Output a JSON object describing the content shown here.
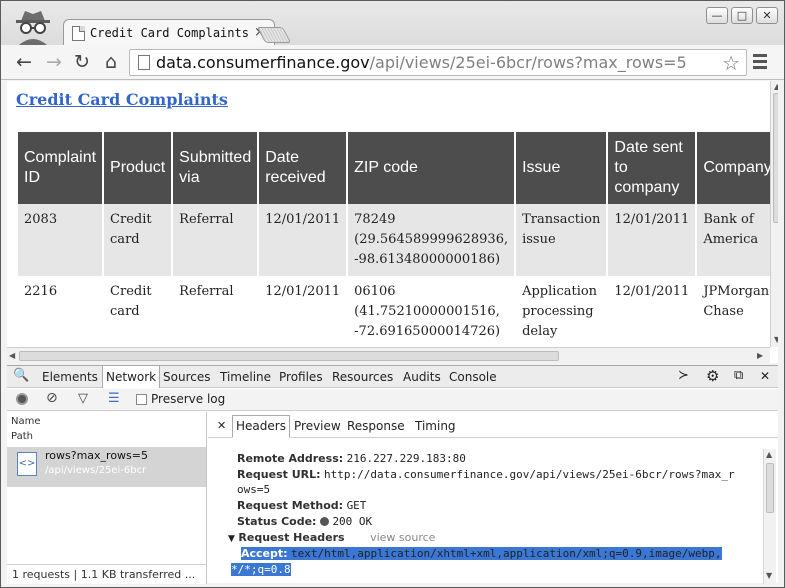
{
  "browser": {
    "tab_title": "Credit Card Complaints",
    "url_host": "data.consumerfinance.gov",
    "url_path": "/api/views/25ei-6bcr/rows?max_rows=5",
    "window_buttons": {
      "minimize": "—",
      "maximize": "□",
      "close": "✕"
    },
    "tab_close": "×"
  },
  "page": {
    "title": "Credit Card Complaints",
    "columns": [
      "Complaint ID",
      "Product",
      "Submitted via",
      "Date received",
      "ZIP code",
      "Issue",
      "Date sent to company",
      "Company"
    ],
    "rows": [
      [
        "2083",
        "Credit card",
        "Referral",
        "12/01/2011",
        "78249 (29.564589999628936, -98.61348000000186)",
        "Transaction issue",
        "12/01/2011",
        "Bank of America"
      ],
      [
        "2216",
        "Credit card",
        "Referral",
        "12/01/2011",
        "06106 (41.75210000001516, -72.69165000014726)",
        "Application processing delay",
        "12/01/2011",
        "JPMorgan Chase"
      ]
    ]
  },
  "devtools": {
    "tabs": [
      "Elements",
      "Network",
      "Sources",
      "Timeline",
      "Profiles",
      "Resources",
      "Audits",
      "Console"
    ],
    "active_tab": "Network",
    "preserve_log": "Preserve log",
    "list_headers": {
      "name": "Name",
      "path": "Path"
    },
    "request": {
      "name": "rows?max_rows=5",
      "path": "/api/views/25ei-6bcr"
    },
    "summary": "1 requests  |  1.1 KB transferred ...",
    "detail_tabs": [
      "Headers",
      "Preview",
      "Response",
      "Timing"
    ],
    "headers": {
      "remote_address_label": "Remote Address:",
      "remote_address": "216.227.229.183:80",
      "request_url_label": "Request URL:",
      "request_url_1": "http://data.consumerfinance.gov/api/views/25ei-6bcr/rows?max_r",
      "request_url_2": "ows=5",
      "request_method_label": "Request Method:",
      "request_method": "GET",
      "status_code_label": "Status Code:",
      "status_code": "200  OK",
      "section_label": "Request Headers",
      "view_source": "view source",
      "accept_label": "Accept:",
      "accept_1": "text/html,application/xhtml+xml,application/xml;q=0.9,image/webp,",
      "accept_2": "*/*;q=0.8"
    }
  }
}
